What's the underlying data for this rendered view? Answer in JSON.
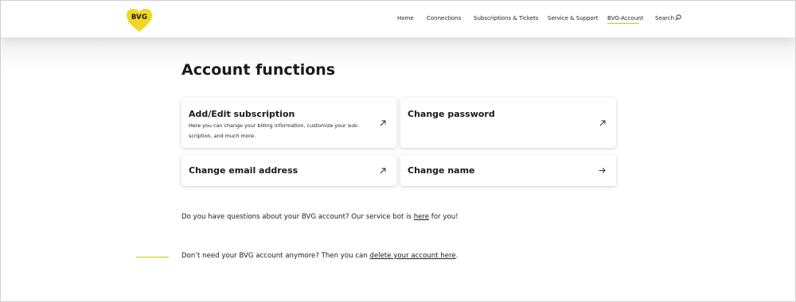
{
  "header": {
    "logo_text": "BVG",
    "nav": [
      {
        "label": "Home"
      },
      {
        "label": "Connections"
      },
      {
        "label": "Subscriptions & Tickets"
      },
      {
        "label": "Service & Support"
      },
      {
        "label": "BVG-Account",
        "active": true
      },
      {
        "label": "Search"
      }
    ]
  },
  "main": {
    "title": "Account functions",
    "cards": [
      {
        "title": "Add/Edit subscription",
        "description": "Here you can change your billing information, customize your sub-scription, and much more.",
        "icon": "external-arrow-icon"
      },
      {
        "title": "Change password",
        "icon": "external-arrow-icon"
      },
      {
        "title": "Change email address",
        "icon": "external-arrow-icon"
      },
      {
        "title": "Change name",
        "icon": "right-arrow-icon"
      }
    ],
    "service_bot": {
      "prefix": "Do you have questions about your BVG account? Our service bot is ",
      "link": "here",
      "suffix": " for you!"
    },
    "delete_account": {
      "prefix": "Don’t need your BVG account anymore? Then you can ",
      "link": "delete your account here",
      "suffix": "."
    }
  },
  "colors": {
    "brand_yellow": "#f0d722",
    "accent_line": "#d9c800"
  }
}
